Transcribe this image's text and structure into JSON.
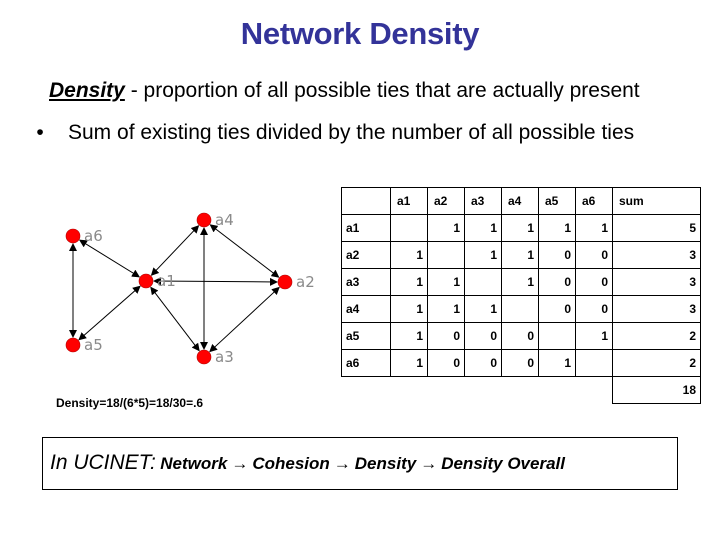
{
  "slide": {
    "title": "Network Density",
    "definition": {
      "term": "Density",
      "text": " - proportion of all possible ties that are actually present"
    },
    "bullet": {
      "symbol": "•",
      "text": "Sum of existing ties divided by the number of all possible ties"
    },
    "density_formula": "Density=18/(6*5)=18/30=.6",
    "ucinet": {
      "lead": "In UCINET:",
      "path": [
        "Network",
        "Cohesion",
        "Density",
        "Density Overall"
      ],
      "arrow_symbol": "→"
    }
  },
  "network": {
    "node_color": "#ff0000",
    "label_color": "#8a8a8a",
    "nodes": [
      {
        "id": "a1",
        "label": "a1"
      },
      {
        "id": "a2",
        "label": "a2"
      },
      {
        "id": "a3",
        "label": "a3"
      },
      {
        "id": "a4",
        "label": "a4"
      },
      {
        "id": "a5",
        "label": "a5"
      },
      {
        "id": "a6",
        "label": "a6"
      }
    ],
    "edges": [
      {
        "from": "a1",
        "to": "a2",
        "bidirectional": true
      },
      {
        "from": "a1",
        "to": "a3",
        "bidirectional": true
      },
      {
        "from": "a1",
        "to": "a4",
        "bidirectional": true
      },
      {
        "from": "a1",
        "to": "a5",
        "bidirectional": true
      },
      {
        "from": "a1",
        "to": "a6",
        "bidirectional": true
      },
      {
        "from": "a2",
        "to": "a3",
        "bidirectional": true
      },
      {
        "from": "a2",
        "to": "a4",
        "bidirectional": true
      },
      {
        "from": "a3",
        "to": "a4",
        "bidirectional": true
      },
      {
        "from": "a5",
        "to": "a6",
        "bidirectional": true
      }
    ]
  },
  "matrix": {
    "columns": [
      "a1",
      "a2",
      "a3",
      "a4",
      "a5",
      "a6"
    ],
    "sum_label": "sum",
    "rows": [
      {
        "label": "a1",
        "values": [
          "",
          "1",
          "1",
          "1",
          "1",
          "1"
        ],
        "sum": "5"
      },
      {
        "label": "a2",
        "values": [
          "1",
          "",
          "1",
          "1",
          "0",
          "0"
        ],
        "sum": "3"
      },
      {
        "label": "a3",
        "values": [
          "1",
          "1",
          "",
          "1",
          "0",
          "0"
        ],
        "sum": "3"
      },
      {
        "label": "a4",
        "values": [
          "1",
          "1",
          "1",
          "",
          "0",
          "0"
        ],
        "sum": "3"
      },
      {
        "label": "a5",
        "values": [
          "1",
          "0",
          "0",
          "0",
          "",
          "1"
        ],
        "sum": "2"
      },
      {
        "label": "a6",
        "values": [
          "1",
          "0",
          "0",
          "0",
          "1",
          ""
        ],
        "sum": "2"
      }
    ],
    "total": "18"
  }
}
